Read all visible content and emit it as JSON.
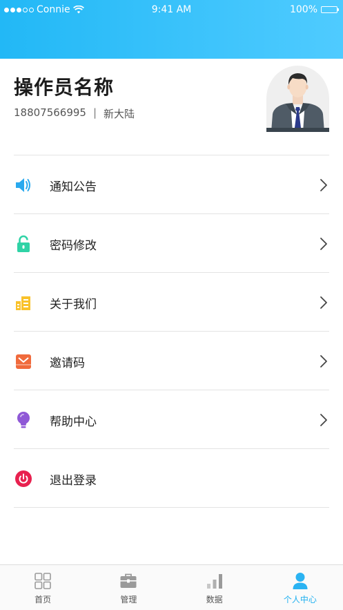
{
  "status_bar": {
    "carrier": "Connie",
    "time": "9:41 AM",
    "battery": "100%"
  },
  "profile": {
    "name": "操作员名称",
    "phone": "18807566995",
    "separator": "|",
    "company": "新大陆"
  },
  "menu": {
    "items": [
      {
        "label": "通知公告",
        "icon": "speaker-icon"
      },
      {
        "label": "密码修改",
        "icon": "lock-icon"
      },
      {
        "label": "关于我们",
        "icon": "building-icon"
      },
      {
        "label": "邀请码",
        "icon": "envelope-icon"
      },
      {
        "label": "帮助中心",
        "icon": "lightbulb-icon"
      },
      {
        "label": "退出登录",
        "icon": "power-icon"
      }
    ]
  },
  "tabbar": {
    "tabs": [
      {
        "label": "首页",
        "icon": "grid-icon"
      },
      {
        "label": "管理",
        "icon": "briefcase-icon"
      },
      {
        "label": "数据",
        "icon": "bar-chart-icon"
      },
      {
        "label": "个人中心",
        "icon": "person-icon",
        "active": true
      }
    ]
  },
  "colors": {
    "header_start": "#22b8f6",
    "header_end": "#4fcbff",
    "active_tab": "#1fb0f0",
    "speaker": "#29a9ee",
    "lock": "#2fd3a6",
    "building": "#f9c22b",
    "envelope": "#f06a3c",
    "lightbulb": "#8f58d6",
    "power": "#e8214f"
  }
}
